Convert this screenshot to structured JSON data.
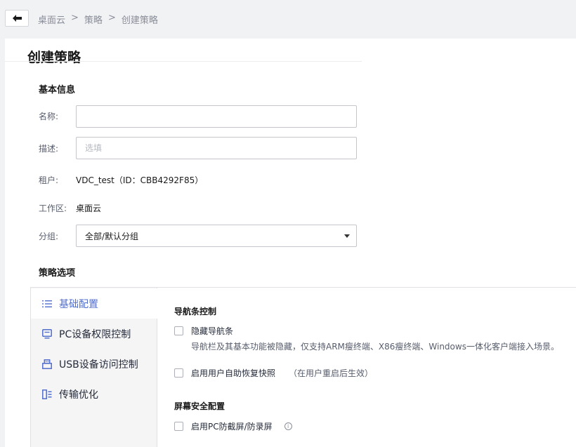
{
  "breadcrumb": {
    "items": [
      "桌面云",
      "策略",
      "创建策略"
    ],
    "separator": ">"
  },
  "page": {
    "title": "创建策略"
  },
  "basic_info": {
    "title": "基本信息",
    "name": {
      "label": "名称:",
      "value": "",
      "placeholder": ""
    },
    "description": {
      "label": "描述:",
      "value": "",
      "placeholder": "选填"
    },
    "tenant": {
      "label": "租户:",
      "value": "VDC_test（ID：CBB4292F85）"
    },
    "workspace": {
      "label": "工作区:",
      "value": "桌面云"
    },
    "group": {
      "label": "分组:",
      "selected": "全部/默认分组"
    }
  },
  "policy_options": {
    "title": "策略选项",
    "nav": [
      {
        "label": "基础配置",
        "icon": "list-icon",
        "active": true
      },
      {
        "label": "PC设备权限控制",
        "icon": "monitor-icon",
        "active": false
      },
      {
        "label": "USB设备访问控制",
        "icon": "usb-icon",
        "active": false
      },
      {
        "label": "传输优化",
        "icon": "transfer-icon",
        "active": false
      }
    ],
    "nav_bar_control": {
      "title": "导航条控制",
      "hide_nav": {
        "label": "隐藏导航条",
        "checked": false,
        "description": "导航栏及其基本功能被隐藏，仅支持ARM瘦终端、X86瘦终端、Windows一体化客户端接入场景。"
      },
      "self_restore": {
        "label": "启用用户自助恢复快照",
        "note": "（在用户重启后生效）",
        "checked": false
      }
    },
    "screen_security": {
      "title": "屏幕安全配置",
      "anti_capture": {
        "label": "启用PC防截屏/防录屏",
        "checked": false
      }
    }
  },
  "colors": {
    "accent": "#526ecc",
    "page_bg": "#f1f2f4",
    "nav_bg": "#f5f5f6",
    "border": "#c4c6cc"
  }
}
